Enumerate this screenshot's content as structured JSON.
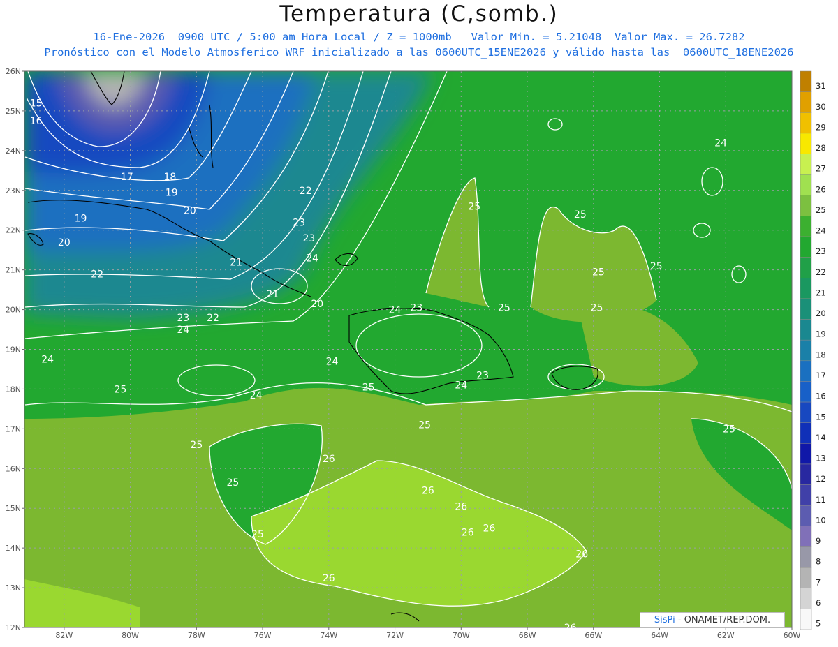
{
  "header": {
    "title": "Temperatura (C,somb.)",
    "subtitle1": "16-Ene-2026  0900 UTC / 5:00 am Hora Local / Z = 1000mb   Valor Min. = 5.21048  Valor Max. = 26.7282",
    "subtitle2": "Pronóstico con el Modelo Atmosferico WRF inicializado a las 0600UTC_15ENE2026 y válido hasta las  0600UTC_18ENE2026"
  },
  "axes": {
    "lat_labels": [
      "26N",
      "25N",
      "24N",
      "23N",
      "22N",
      "21N",
      "20N",
      "19N",
      "18N",
      "17N",
      "16N",
      "15N",
      "14N",
      "13N",
      "12N"
    ],
    "lon_labels": [
      "82W",
      "80W",
      "78W",
      "76W",
      "74W",
      "72W",
      "70W",
      "68W",
      "66W",
      "64W",
      "62W",
      "60W"
    ]
  },
  "colorbar": {
    "labels": [
      "31",
      "30",
      "29",
      "28",
      "27",
      "26",
      "25",
      "24",
      "23",
      "22",
      "21",
      "20",
      "19",
      "18",
      "17",
      "16",
      "15",
      "14",
      "13",
      "12",
      "11",
      "10",
      "9",
      "8",
      "7",
      "6",
      "5"
    ],
    "colors": [
      "#c08000",
      "#e0a000",
      "#f0c000",
      "#f8e800",
      "#c8f050",
      "#a0e050",
      "#7cc040",
      "#3cb030",
      "#22a830",
      "#20a048",
      "#1a9860",
      "#1a9078",
      "#1a8890",
      "#1a80a8",
      "#1a70c0",
      "#1860c8",
      "#1848c0",
      "#1030b8",
      "#1018a8",
      "#2828a0",
      "#4040a8",
      "#5c5cb0",
      "#8070b8",
      "#9898a8",
      "#b4b4b4",
      "#d4d4d4",
      "#f8f8f8"
    ]
  },
  "contour_labels": [
    {
      "text": "15",
      "lon": -82.85,
      "lat": 25.2
    },
    {
      "text": "16",
      "lon": -82.85,
      "lat": 24.75
    },
    {
      "text": "17",
      "lon": -80.1,
      "lat": 23.35
    },
    {
      "text": "18",
      "lon": -78.8,
      "lat": 23.35
    },
    {
      "text": "19",
      "lon": -78.75,
      "lat": 22.95
    },
    {
      "text": "19",
      "lon": -81.5,
      "lat": 22.3
    },
    {
      "text": "20",
      "lon": -78.2,
      "lat": 22.5
    },
    {
      "text": "20",
      "lon": -82.0,
      "lat": 21.7
    },
    {
      "text": "21",
      "lon": -76.8,
      "lat": 21.2
    },
    {
      "text": "21",
      "lon": -75.7,
      "lat": 20.4
    },
    {
      "text": "22",
      "lon": -81.0,
      "lat": 20.9
    },
    {
      "text": "22",
      "lon": -77.5,
      "lat": 19.8
    },
    {
      "text": "22",
      "lon": -74.7,
      "lat": 23.0
    },
    {
      "text": "23",
      "lon": -78.4,
      "lat": 19.8
    },
    {
      "text": "23",
      "lon": -74.9,
      "lat": 22.2
    },
    {
      "text": "23",
      "lon": -74.6,
      "lat": 21.8
    },
    {
      "text": "24",
      "lon": -78.4,
      "lat": 19.5
    },
    {
      "text": "24",
      "lon": -74.5,
      "lat": 21.3
    },
    {
      "text": "24",
      "lon": -82.5,
      "lat": 18.75
    },
    {
      "text": "24",
      "lon": -73.9,
      "lat": 18.7
    },
    {
      "text": "24",
      "lon": -72.0,
      "lat": 20.0
    },
    {
      "text": "24",
      "lon": -76.2,
      "lat": 17.85
    },
    {
      "text": "24",
      "lon": -70.0,
      "lat": 18.1
    },
    {
      "text": "24",
      "lon": -62.15,
      "lat": 24.2
    },
    {
      "text": "20",
      "lon": -74.35,
      "lat": 20.15
    },
    {
      "text": "23",
      "lon": -71.35,
      "lat": 20.05
    },
    {
      "text": "23",
      "lon": -69.35,
      "lat": 18.35
    },
    {
      "text": "25",
      "lon": -80.3,
      "lat": 18.0
    },
    {
      "text": "25",
      "lon": -78.0,
      "lat": 16.6
    },
    {
      "text": "25",
      "lon": -72.8,
      "lat": 18.05
    },
    {
      "text": "25",
      "lon": -71.1,
      "lat": 17.1
    },
    {
      "text": "25",
      "lon": -69.6,
      "lat": 22.6
    },
    {
      "text": "25",
      "lon": -66.4,
      "lat": 22.4
    },
    {
      "text": "25",
      "lon": -68.7,
      "lat": 20.05
    },
    {
      "text": "25",
      "lon": -65.85,
      "lat": 20.95
    },
    {
      "text": "25",
      "lon": -65.9,
      "lat": 20.05
    },
    {
      "text": "25",
      "lon": -64.1,
      "lat": 21.1
    },
    {
      "text": "25",
      "lon": -61.9,
      "lat": 17.0
    },
    {
      "text": "25",
      "lon": -76.9,
      "lat": 15.65
    },
    {
      "text": "25",
      "lon": -76.15,
      "lat": 14.35
    },
    {
      "text": "26",
      "lon": -74.0,
      "lat": 16.25
    },
    {
      "text": "26",
      "lon": -71.0,
      "lat": 15.45
    },
    {
      "text": "26",
      "lon": -70.0,
      "lat": 15.05
    },
    {
      "text": "26",
      "lon": -69.15,
      "lat": 14.5
    },
    {
      "text": "26",
      "lon": -69.8,
      "lat": 14.4
    },
    {
      "text": "26",
      "lon": -74.0,
      "lat": 13.25
    },
    {
      "text": "26",
      "lon": -66.35,
      "lat": 13.85
    },
    {
      "text": "26",
      "lon": -66.7,
      "lat": 12.0
    }
  ],
  "credit": {
    "brand": "SisPi",
    "rest": " - ONAMET/REP.DOM."
  }
}
